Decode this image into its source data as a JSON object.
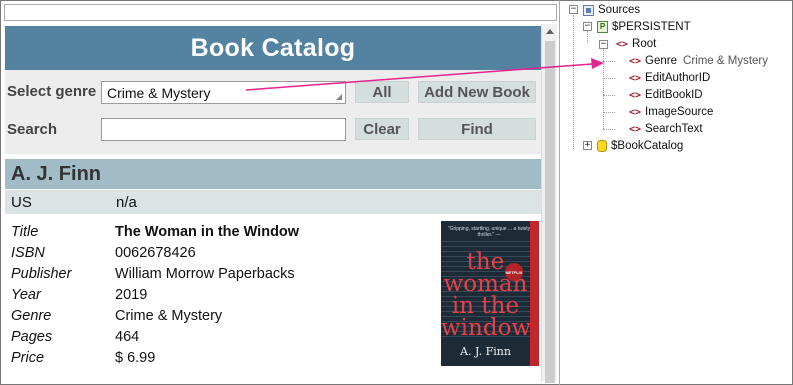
{
  "catalog": {
    "title": "Book Catalog",
    "genre_label": "Select genre",
    "genre_value": "Crime & Mystery",
    "all_button": "All",
    "add_button": "Add New Book",
    "search_label": "Search",
    "search_value": "",
    "clear_button": "Clear",
    "find_button": "Find"
  },
  "author": {
    "name": "A. J. Finn",
    "country": "US",
    "extra": "n/a"
  },
  "book": {
    "fields": [
      {
        "key": "Title",
        "value": "The Woman in the Window"
      },
      {
        "key": "ISBN",
        "value": "0062678426"
      },
      {
        "key": "Publisher",
        "value": "William Morrow Paperbacks"
      },
      {
        "key": "Year",
        "value": "2019"
      },
      {
        "key": "Genre",
        "value": "Crime & Mystery"
      },
      {
        "key": "Pages",
        "value": "464"
      },
      {
        "key": "Price",
        "value": "$ 6.99"
      }
    ],
    "cover": {
      "blurb": "\"Gripping, startling, unique ... a twisty thriller.\" — ",
      "title_lines": [
        "the",
        "woman",
        "in the",
        "window"
      ],
      "badge": "NETFLIX",
      "author": "A. J. Finn"
    }
  },
  "tree": {
    "sources": "Sources",
    "persistent": "$PERSISTENT",
    "root": "Root",
    "genre": "Genre",
    "genre_value": "Crime & Mystery",
    "edit_author": "EditAuthorID",
    "edit_book": "EditBookID",
    "image_source": "ImageSource",
    "search_text": "SearchText",
    "book_catalog": "$BookCatalog"
  },
  "colors": {
    "title_bar": "#5383a1",
    "author_bar": "#a1bcc7",
    "arrow": "#e4248f"
  }
}
